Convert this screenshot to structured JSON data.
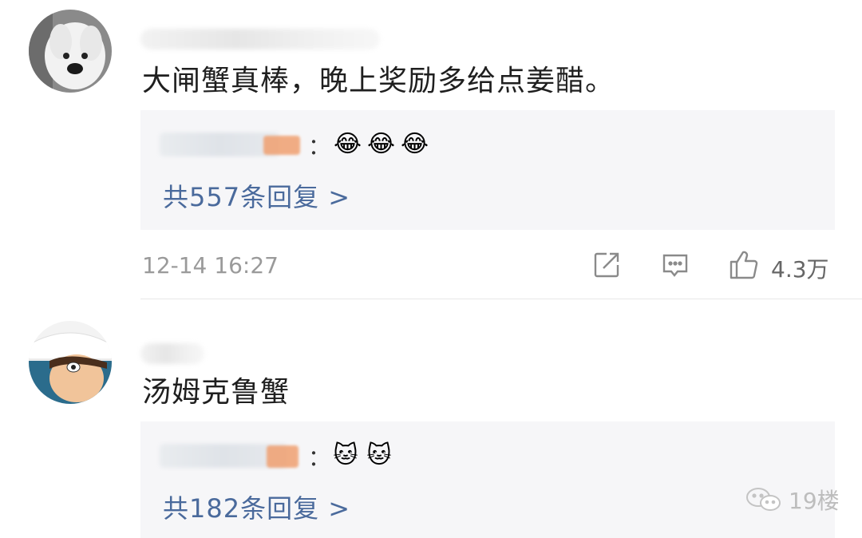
{
  "comments": [
    {
      "text": "大闸蟹真棒，晚上奖励多给点姜醋。",
      "reply_emojis": [
        "😂",
        "😂",
        "😂"
      ],
      "reply_colon": "：",
      "reply_count_label": "共557条回复 >",
      "timestamp": "12-14 16:27",
      "likes": "4.3万"
    },
    {
      "text": "汤姆克鲁蟹",
      "reply_emojis": [
        "🐱",
        "🐱"
      ],
      "reply_colon": "：",
      "reply_count_label": "共182条回复 >"
    }
  ],
  "watermark": "19楼",
  "icons": {
    "share": "share-icon",
    "comment": "comment-icon",
    "like": "thumbs-up-icon",
    "watermark_logo": "wechat-icon"
  },
  "colors": {
    "reply_link": "#4a6a9c",
    "reply_bg": "#f6f6f8",
    "meta_text": "#9a9a9a"
  }
}
